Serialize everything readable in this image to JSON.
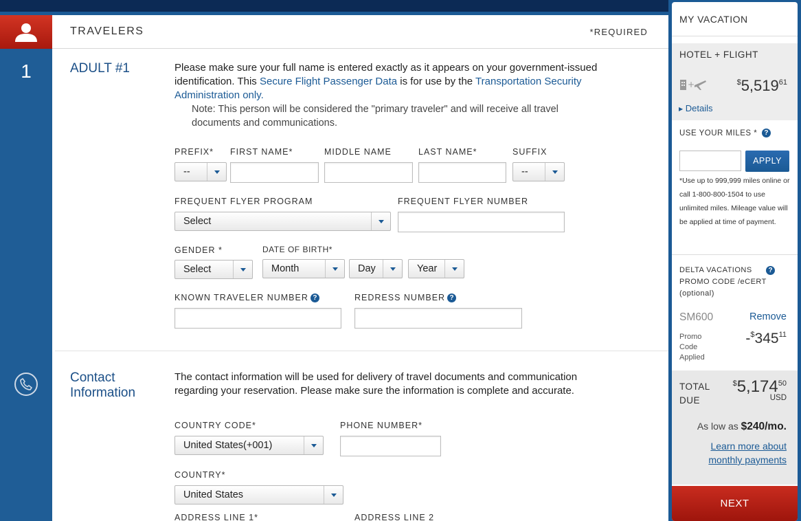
{
  "travelers": {
    "header": "TRAVELERS",
    "required": "*REQUIRED",
    "step_number": "1",
    "adult_title": "ADULT #1",
    "intro_1": "Please make sure your full name is entered exactly as it appears on your government-issued identification. This ",
    "intro_link_1": "Secure Flight Passenger Data",
    "intro_2": " is for use by the ",
    "intro_link_2": "Transportation Security Administration only.",
    "note": "Note: This person will be considered the \"primary traveler\" and will receive all travel documents and communications.",
    "fields": {
      "prefix_label": "PREFIX*",
      "prefix_value": "--",
      "first_name_label": "FIRST NAME*",
      "middle_name_label": "MIDDLE NAME",
      "last_name_label": "LAST NAME*",
      "suffix_label": "SUFFIX",
      "suffix_value": "--",
      "ff_program_label": "FREQUENT FLYER PROGRAM",
      "ff_program_value": "Select",
      "ff_number_label": "FREQUENT FLYER NUMBER",
      "gender_label": "GENDER *",
      "gender_value": "Select",
      "dob_label": "DATE OF BIRTH*",
      "month_value": "Month",
      "day_value": "Day",
      "year_value": "Year",
      "ktn_label": "KNOWN TRAVELER NUMBER",
      "redress_label": "REDRESS NUMBER"
    }
  },
  "contact": {
    "title": "Contact Information",
    "intro": "The contact information will be used for delivery of travel documents and communication regarding your reservation. Please make sure the information is complete and accurate.",
    "country_code_label": "COUNTRY CODE*",
    "country_code_value": "United States(+001)",
    "phone_label": "PHONE NUMBER*",
    "country_label": "COUNTRY*",
    "country_value": "United States",
    "address1_label": "ADDRESS LINE 1*",
    "address2_label": "ADDRESS LINE 2"
  },
  "sidebar": {
    "title": "MY VACATION",
    "package": "HOTEL + FLIGHT",
    "package_price_symbol": "$",
    "package_price_main": "5,519",
    "package_price_cents": "61",
    "details_link": "Details",
    "miles_label": "USE YOUR MILES *",
    "apply_button": "APPLY",
    "miles_note": "*Use up to 999,999 miles online or call 1-800-800-1504 to use unlimited miles. Mileage value will be applied at time of payment.",
    "promo_label": "DELTA VACATIONS PROMO CODE /eCERT (optional)",
    "promo_code": "SM600",
    "remove_link": "Remove",
    "promo_applied": "Promo Code Applied",
    "discount_prefix": "-",
    "discount_symbol": "$",
    "discount_main": "345",
    "discount_cents": "11",
    "total_label": "TOTAL DUE",
    "total_symbol": "$",
    "total_main": "5,174",
    "total_cents": "50",
    "currency": "USD",
    "as_low_as": "As low as",
    "monthly": "$240/mo.",
    "learn_more": "Learn more about monthly payments",
    "next_button": "NEXT"
  },
  "colors": {
    "accent_blue": "#1b5a95",
    "brand_red": "#c92c1f"
  }
}
